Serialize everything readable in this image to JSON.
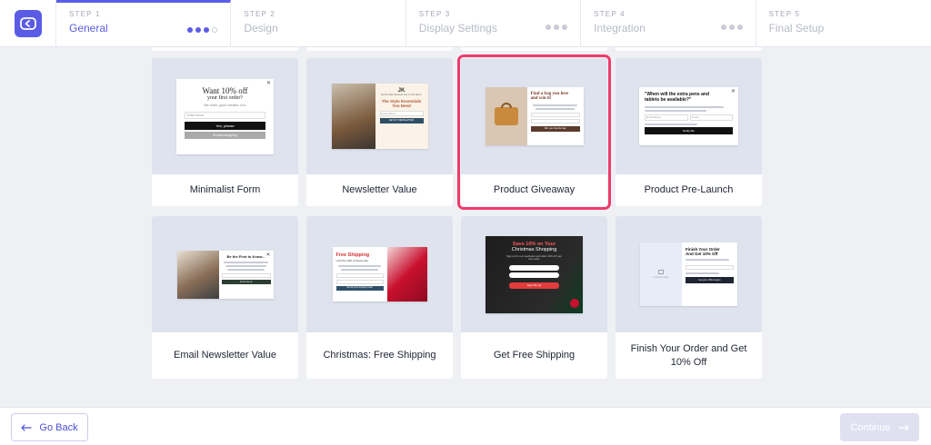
{
  "steps": [
    {
      "num": "STEP 1",
      "name": "General",
      "active": true,
      "progress": [
        1,
        1,
        1,
        0
      ]
    },
    {
      "num": "STEP 2",
      "name": "Design"
    },
    {
      "num": "STEP 3",
      "name": "Display Settings",
      "progress": [
        0,
        0,
        0
      ]
    },
    {
      "num": "STEP 4",
      "name": "Integration",
      "progress": [
        0,
        0,
        0
      ]
    },
    {
      "num": "STEP 5",
      "name": "Final Setup"
    }
  ],
  "colors": {
    "accent": "#5b5ce6",
    "selected_outline": "#ef3b6c"
  },
  "templates": [
    {
      "label": "Minimalist Form",
      "selected": false
    },
    {
      "label": "Newsletter Value",
      "selected": false
    },
    {
      "label": "Product Giveaway",
      "selected": true
    },
    {
      "label": "Product Pre-Launch",
      "selected": false
    },
    {
      "label": "Email Newsletter Value",
      "selected": false
    },
    {
      "label": "Christmas: Free Shipping",
      "selected": false
    },
    {
      "label": "Get Free Shipping",
      "selected": false
    },
    {
      "label": "Finish Your Order and Get 10% Off",
      "selected": false
    }
  ],
  "previews": {
    "minimalist": {
      "title": "Want 10% off",
      "subtitle": "your first order?",
      "sub2": "We write good emails, too.",
      "input": "Enter email",
      "cta": "Yes, please",
      "secondary": "I'll keep shopping"
    },
    "newsletter": {
      "logo": "JK",
      "tagline": "Be The Best Dressed Guy In The Room",
      "headline1": "The Style Essentials",
      "headline2": "You Need",
      "input": "Email Address",
      "cta": "GET MY NEWSLETTER"
    },
    "giveaway": {
      "title1": "Find a bag you love",
      "title2": "and win it!",
      "cta": "Win your favorite bag"
    },
    "prelaunch": {
      "title1": "\"When will the extra pens and",
      "title2": "tablets be available?\"",
      "email": "Email address",
      "country": "Country",
      "cta": "Notify Me"
    },
    "email_value": {
      "title": "Be the First to Know...",
      "cta": "Count me in"
    },
    "christmas": {
      "title": "Free Shipping",
      "subtitle": "Until the 24th of December",
      "cta": "Get My Free Shipping Code"
    },
    "getfree": {
      "title1": "Save 10% on Your",
      "title2": "Christmas Shopping",
      "sub": "Sign up for our newsletter and claim 10% off your next order.",
      "cta": "Sign Me Up"
    },
    "finish": {
      "title1": "Finish Your Order",
      "title2": "And Get 10% Off",
      "placeholder": "Optional Image",
      "cta": "Get your 10% coupon"
    }
  },
  "footer": {
    "back": "Go Back",
    "continue": "Continue"
  }
}
